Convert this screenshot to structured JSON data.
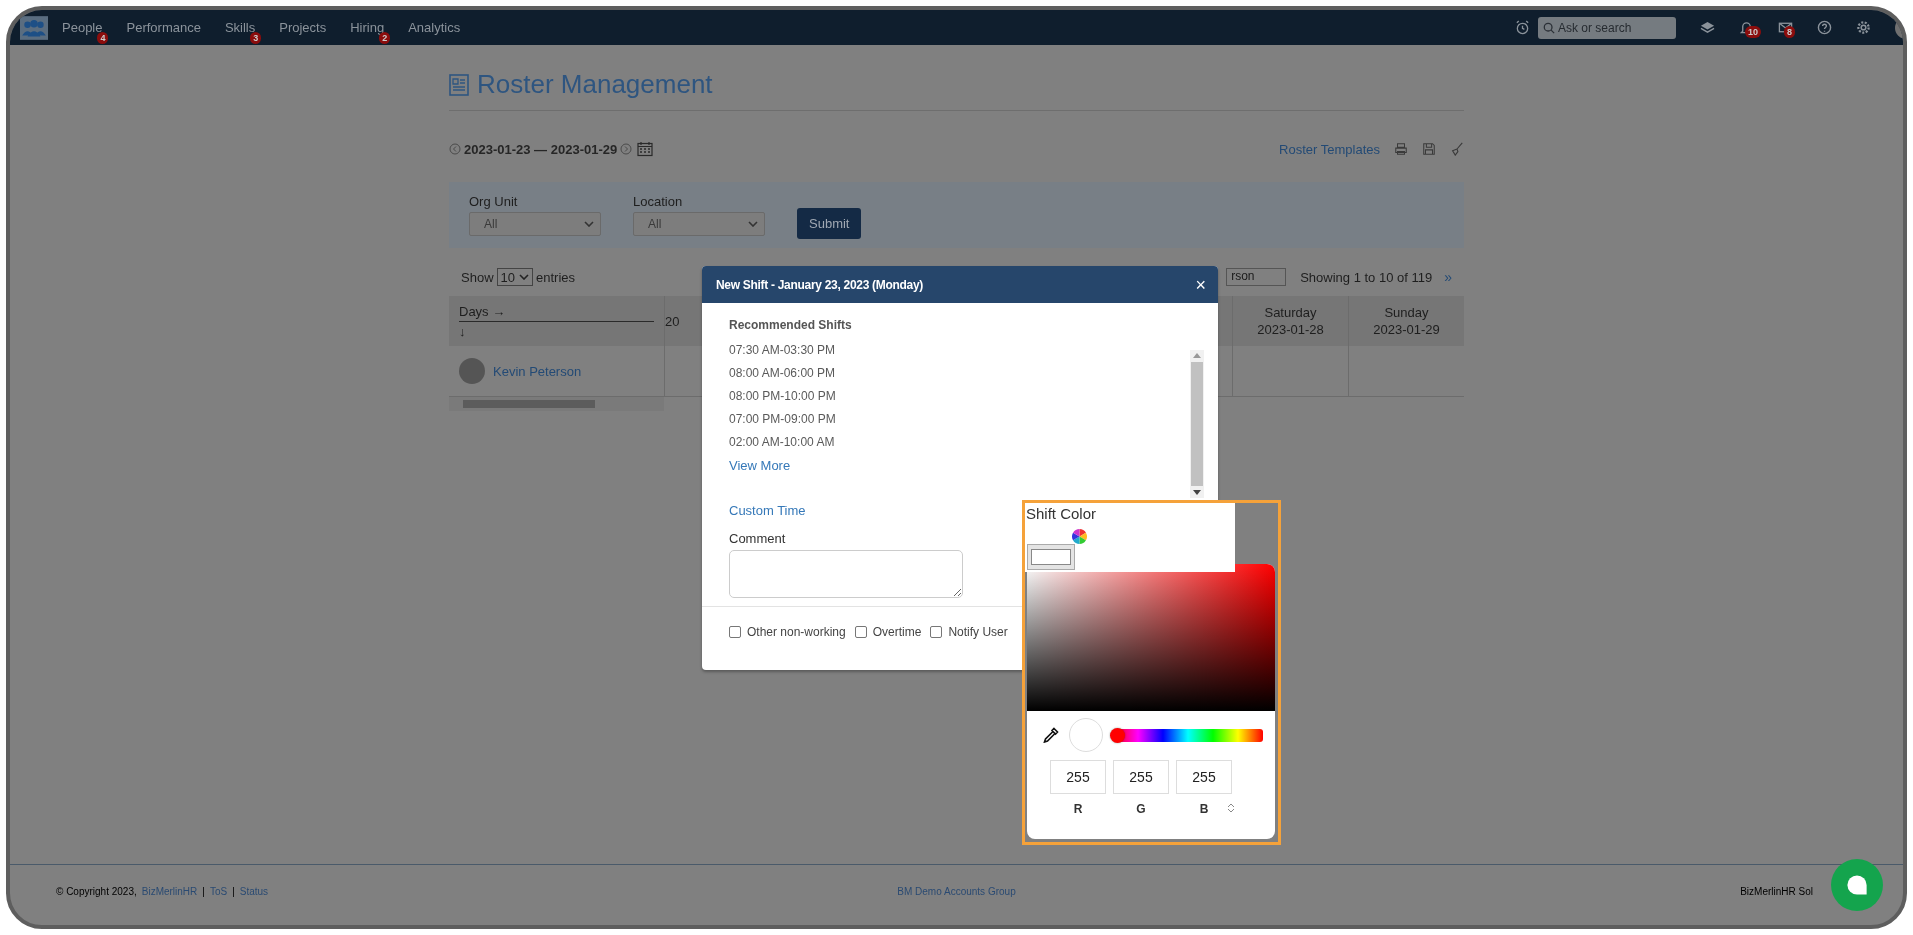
{
  "nav": {
    "items": [
      {
        "label": "People",
        "badge": "4"
      },
      {
        "label": "Performance"
      },
      {
        "label": "Skills",
        "badge": "3"
      },
      {
        "label": "Projects"
      },
      {
        "label": "Hiring",
        "badge": "2"
      },
      {
        "label": "Analytics"
      }
    ],
    "search": {
      "placeholder": "Ask or search"
    },
    "notifications_badge": "10",
    "messages_badge": "8"
  },
  "page": {
    "title": "Roster Management",
    "date_range": "2023-01-23 — 2023-01-29",
    "roster_templates": "Roster Templates"
  },
  "filters": [
    {
      "label": "Org Unit",
      "value": "All"
    },
    {
      "label": "Location",
      "value": "All"
    }
  ],
  "submit": "Submit",
  "table": {
    "show": "Show",
    "page_size": "10",
    "entries": "entries",
    "search_value": "rson",
    "info": "Showing 1 to 10 of 119",
    "next": "»",
    "columns": [
      {
        "line1": "Days →",
        "line2": "↓"
      },
      {
        "line2": "20"
      },
      {
        "line1": "Saturday",
        "line2": "2023-01-28"
      },
      {
        "line1": "Sunday",
        "line2": "2023-01-29"
      }
    ],
    "rows": [
      {
        "name": "Kevin Peterson"
      }
    ]
  },
  "modal": {
    "title": "New Shift - January 23, 2023 (Monday)",
    "close": "×",
    "section": "Recommended Shifts",
    "shifts": [
      "07:30 AM-03:30 PM",
      "08:00 AM-06:00 PM",
      "08:00 PM-10:00 PM",
      "07:00 PM-09:00 PM",
      "02:00 AM-10:00 AM"
    ],
    "view_more": "View More",
    "custom_time": "Custom Time",
    "comment_label": "Comment",
    "options": [
      {
        "label": "Other non-working",
        "checked": false
      },
      {
        "label": "Overtime",
        "checked": false
      },
      {
        "label": "Notify User",
        "checked": false
      }
    ]
  },
  "color_picker": {
    "label": "Shift Color",
    "hue": {
      "level": 0
    },
    "channels": [
      {
        "value": "255",
        "label": "R"
      },
      {
        "value": "255",
        "label": "G"
      },
      {
        "value": "255",
        "label": "B"
      }
    ]
  },
  "footer": {
    "copyright": "© Copyright 2023,",
    "company": "BizMerlinHR",
    "sep1": "|",
    "tos": "ToS",
    "sep2": "|",
    "status": "Status",
    "center": "BM Demo Accounts Group",
    "right": "BizMerlinHR Sol"
  }
}
